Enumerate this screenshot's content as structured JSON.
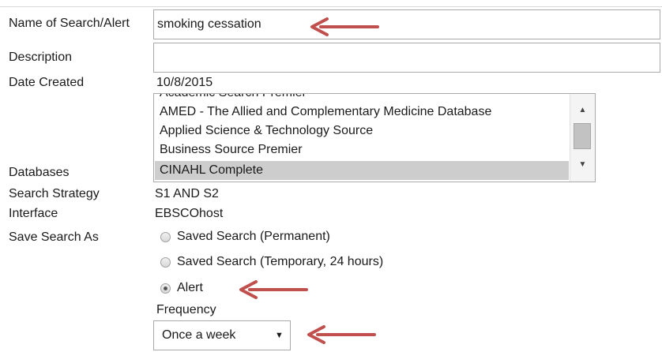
{
  "form": {
    "name_label": "Name of Search/Alert",
    "name_value": "smoking cessation",
    "description_label": "Description",
    "description_value": "",
    "date_created_label": "Date Created",
    "date_created_value": "10/8/2015",
    "databases_label": "Databases",
    "databases": {
      "options": [
        "Academic Search Premier",
        "AMED - The Allied and Complementary Medicine Database",
        "Applied Science & Technology Source",
        "Business Source Premier",
        "CINAHL Complete"
      ],
      "selected": "CINAHL Complete"
    },
    "search_strategy_label": "Search Strategy",
    "search_strategy_value": "S1 AND S2",
    "interface_label": "Interface",
    "interface_value": "EBSCOhost",
    "save_as_label": "Save Search As",
    "save_options": [
      {
        "label": "Saved Search (Permanent)",
        "checked": false
      },
      {
        "label": "Saved Search (Temporary, 24 hours)",
        "checked": false
      },
      {
        "label": "Alert",
        "checked": true
      }
    ],
    "frequency_label": "Frequency",
    "frequency_value": "Once a week"
  },
  "annotation_color": "#c0504d"
}
